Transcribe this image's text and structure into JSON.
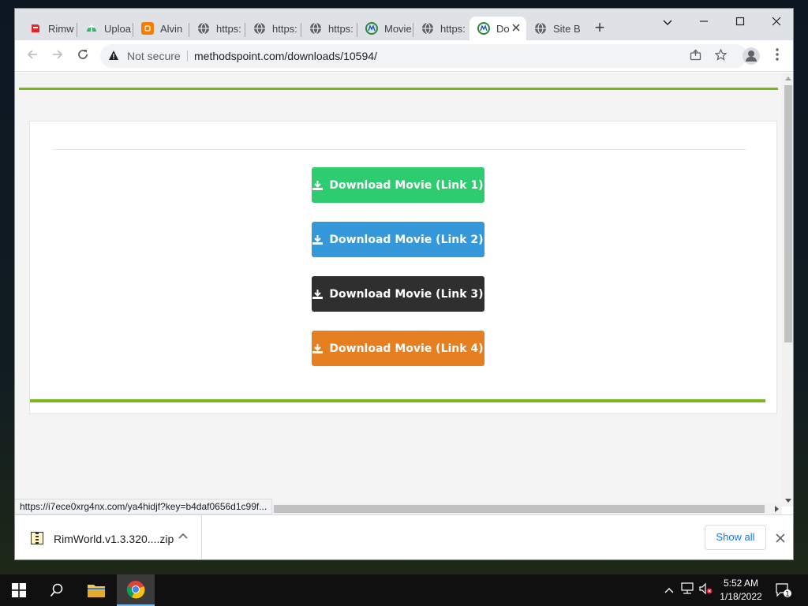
{
  "browser": {
    "tabs": [
      {
        "label": "Rimw",
        "icon": "rimworld-icon",
        "color": "#e8242b"
      },
      {
        "label": "Uploa",
        "icon": "upload-icon",
        "color": "#31b56a"
      },
      {
        "label": "Alvin",
        "icon": "blogger-icon",
        "color": "#f57d00"
      },
      {
        "label": "https:",
        "icon": "globe-icon",
        "color": "#5f6368"
      },
      {
        "label": "https:",
        "icon": "globe-icon",
        "color": "#5f6368"
      },
      {
        "label": "https:",
        "icon": "globe-icon",
        "color": "#5f6368"
      },
      {
        "label": "Movie",
        "icon": "methodspoint-icon",
        "color": "#2a8a3c"
      },
      {
        "label": "https:",
        "icon": "globe-icon",
        "color": "#5f6368"
      },
      {
        "label": "Do",
        "icon": "methodspoint-icon",
        "color": "#2a8a3c",
        "active": true
      },
      {
        "label": "Site B",
        "icon": "globe-icon",
        "color": "#5f6368"
      }
    ],
    "new_tab_label": "+",
    "address": {
      "security_label": "Not secure",
      "url": "methodspoint.com/downloads/10594/"
    },
    "status_url": "https://i7ece0xrg4nx.com/ya4hidjf?key=b4daf0656d1c99f..."
  },
  "page": {
    "buttons": [
      {
        "label": "Download Movie (Link 1)",
        "color": "#2ecc71"
      },
      {
        "label": "Download Movie (Link 2)",
        "color": "#3498db"
      },
      {
        "label": "Download Movie (Link 3)",
        "color": "#2f2f2f"
      },
      {
        "label": "Download Movie (Link 4)",
        "color": "#e67e22"
      }
    ],
    "accent": "#7cb518"
  },
  "downloads": {
    "file_name": "RimWorld.v1.3.320....zip",
    "show_all_label": "Show all"
  },
  "taskbar": {
    "time": "5:52 AM",
    "date": "1/18/2022",
    "notification_count": "1"
  }
}
